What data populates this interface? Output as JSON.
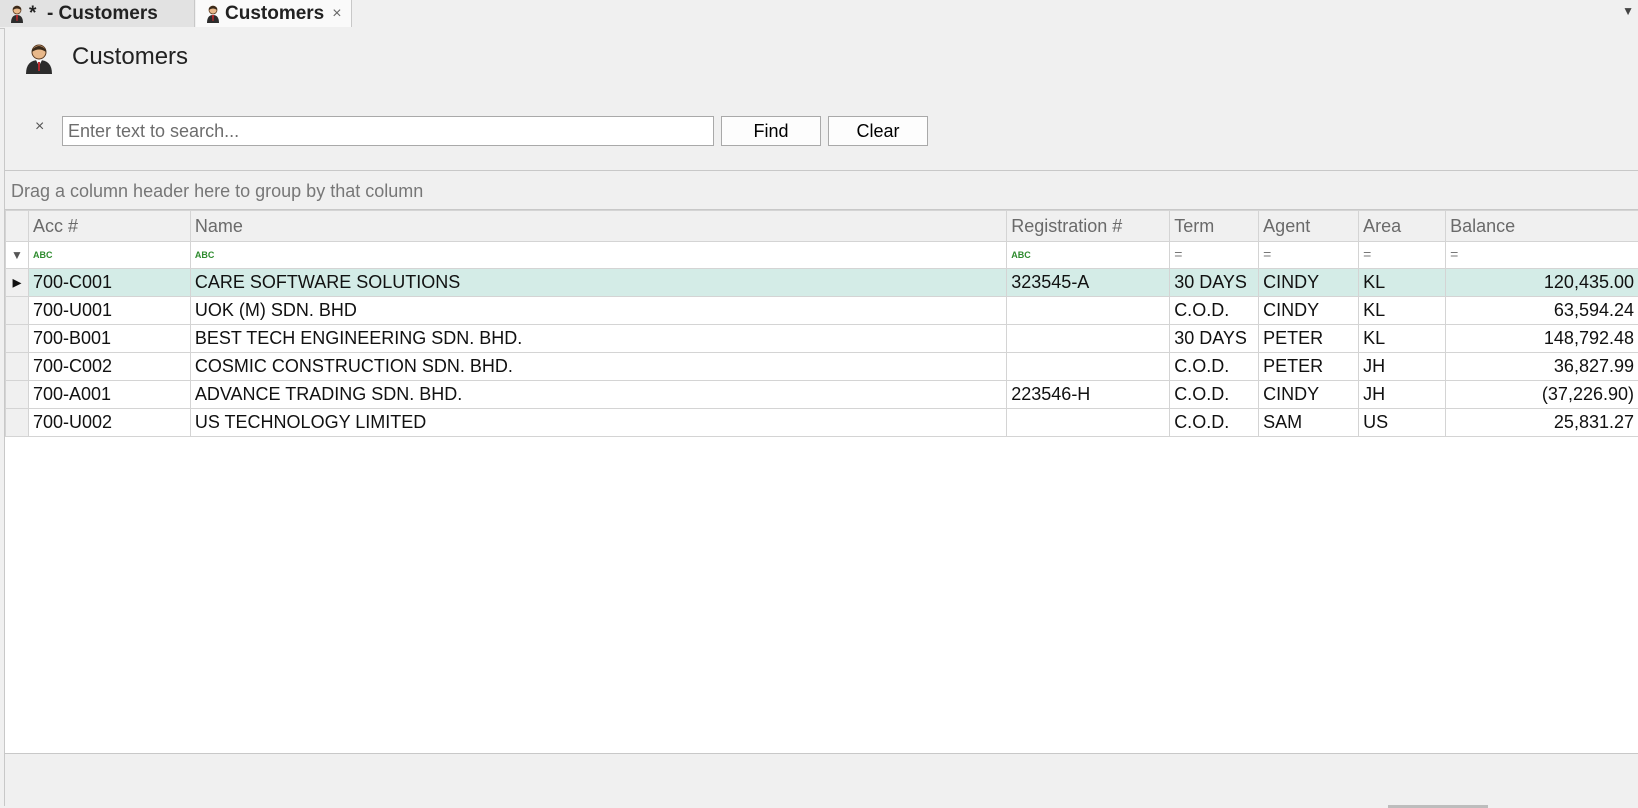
{
  "tabs": [
    {
      "label": "*  - Customers",
      "active": false
    },
    {
      "label": "Customers",
      "active": true,
      "close": "×"
    }
  ],
  "header": {
    "title": "Customers"
  },
  "search": {
    "placeholder": "Enter text to search...",
    "value": "",
    "clear_glyph": "×",
    "find_label": "Find",
    "clear_label": "Clear"
  },
  "grid": {
    "group_panel_text": "Drag a column header here to group by that column",
    "columns": [
      {
        "label": "Acc #",
        "filter": "abc"
      },
      {
        "label": "Name",
        "filter": "abc"
      },
      {
        "label": "Registration #",
        "filter": "abc"
      },
      {
        "label": "Term",
        "filter": "eq"
      },
      {
        "label": "Agent",
        "filter": "eq"
      },
      {
        "label": "Area",
        "filter": "eq"
      },
      {
        "label": "Balance",
        "filter": "eq"
      }
    ],
    "rows": [
      {
        "acc": "700-C001",
        "name": "CARE SOFTWARE SOLUTIONS",
        "reg": "323545-A",
        "term": "30 DAYS",
        "agent": "CINDY",
        "area": "KL",
        "balance": "120,435.00",
        "selected": true
      },
      {
        "acc": "700-U001",
        "name": "UOK (M) SDN. BHD",
        "reg": "",
        "term": "C.O.D.",
        "agent": "CINDY",
        "area": "KL",
        "balance": "63,594.24"
      },
      {
        "acc": "700-B001",
        "name": "BEST TECH ENGINEERING SDN. BHD.",
        "reg": "",
        "term": "30 DAYS",
        "agent": "PETER",
        "area": "KL",
        "balance": "148,792.48"
      },
      {
        "acc": "700-C002",
        "name": "COSMIC CONSTRUCTION SDN. BHD.",
        "reg": "",
        "term": "C.O.D.",
        "agent": "PETER",
        "area": "JH",
        "balance": "36,827.99"
      },
      {
        "acc": "700-A001",
        "name": "ADVANCE TRADING SDN. BHD.",
        "reg": "223546-H",
        "term": "C.O.D.",
        "agent": "CINDY",
        "area": "JH",
        "balance": "(37,226.90)"
      },
      {
        "acc": "700-U002",
        "name": "US TECHNOLOGY LIMITED",
        "reg": "",
        "term": "C.O.D.",
        "agent": "SAM",
        "area": "US",
        "balance": "25,831.27"
      }
    ]
  },
  "icons": {
    "tab_icon": "customer-icon",
    "header_icon": "customer-icon",
    "filter": "filter-icon",
    "row_indicator": "▸",
    "abc_filter": "ABC",
    "eq_filter": "="
  },
  "colors": {
    "selected_row": "#d4ece7",
    "background": "#f0f0f0"
  }
}
